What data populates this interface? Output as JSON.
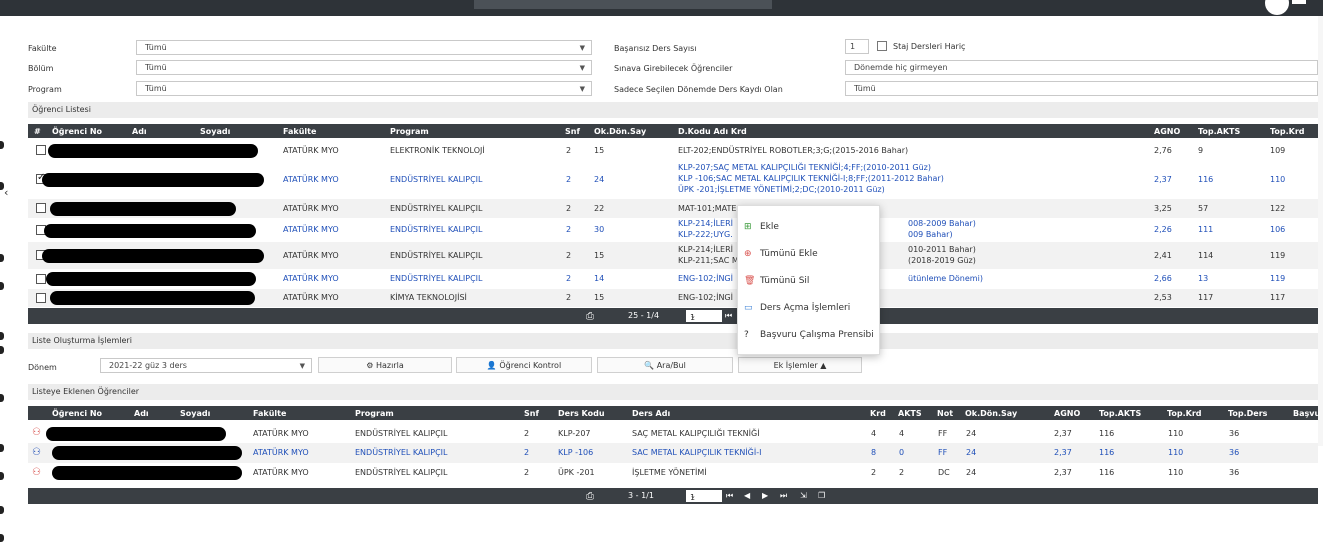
{
  "filters": {
    "fakulte": {
      "label": "Fakülte",
      "value": "Tümü"
    },
    "bolum": {
      "label": "Bölüm",
      "value": "Tümü"
    },
    "program": {
      "label": "Program",
      "value": "Tümü"
    },
    "basarisiz_ders": {
      "label": "Başarısız Ders Sayısı",
      "value": "1"
    },
    "staj_haric": {
      "label": "Staj Dersleri Hariç",
      "checked": false
    },
    "sinava": {
      "label": "Sınava Girebilecek Öğrenciler",
      "value": "Dönemde hiç girmeyen"
    },
    "sadece_secilen": {
      "label": "Sadece Seçilen Dönemde Ders Kaydı Olan",
      "value": "Tümü"
    }
  },
  "ogrenci_listesi": {
    "title": "Öğrenci Listesi",
    "headers": [
      "#",
      "Öğrenci No",
      "Adı",
      "Soyadı",
      "Fakülte",
      "Program",
      "Snf",
      "Ok.Dön.Say",
      "D.Kodu Adı Krd",
      "AGNO",
      "Top.AKTS",
      "Top.Krd"
    ],
    "rows": [
      {
        "fakulte": "ATATÜRK MYO",
        "program": "ELEKTRONİK TEKNOLOJİ",
        "snf": "2",
        "ok": "15",
        "d": [
          "ELT-202;ENDÜSTRİYEL ROBOTLER;3;G;(2015-2016 Bahar)"
        ],
        "agno": "2,76",
        "akts": "9",
        "krd": "109",
        "blue": false,
        "checked": false
      },
      {
        "fakulte": "ATATÜRK MYO",
        "program": "ENDÜSTRİYEL KALIPÇIL",
        "snf": "2",
        "ok": "24",
        "d": [
          "KLP-207;SAÇ METAL KALIPÇILIĞI TEKNİĞİ;4;FF;(2010-2011 Güz)",
          "KLP -106;SAC METAL KALIPÇILIK TEKNİĞİ-I;8;FF;(2011-2012 Bahar)",
          "ÜPK -201;İŞLETME YÖNETİMİ;2;DC;(2010-2011 Güz)"
        ],
        "agno": "2,37",
        "akts": "116",
        "krd": "110",
        "blue": true,
        "checked": true
      },
      {
        "fakulte": "ATATÜRK MYO",
        "program": "ENDÜSTRİYEL KALIPÇIL",
        "snf": "2",
        "ok": "22",
        "d": [
          "MAT-101;MATE"
        ],
        "agno": "3,25",
        "akts": "57",
        "krd": "122",
        "blue": false,
        "checked": false
      },
      {
        "fakulte": "ATATÜRK MYO",
        "program": "ENDÜSTRİYEL KALIPÇIL",
        "snf": "2",
        "ok": "30",
        "d": [
          "KLP-214;İLERİ",
          "KLP-222;UYG."
        ],
        "d2": [
          "008-2009 Bahar)",
          "009 Bahar)"
        ],
        "agno": "2,26",
        "akts": "111",
        "krd": "106",
        "blue": true,
        "checked": false
      },
      {
        "fakulte": "ATATÜRK MYO",
        "program": "ENDÜSTRİYEL KALIPÇIL",
        "snf": "2",
        "ok": "15",
        "d": [
          "KLP-214;İLERİ",
          "KLP-211;SAC M"
        ],
        "d2": [
          "010-2011 Bahar)",
          "(2018-2019 Güz)"
        ],
        "agno": "2,41",
        "akts": "114",
        "krd": "119",
        "blue": false,
        "checked": false
      },
      {
        "fakulte": "ATATÜRK MYO",
        "program": "ENDÜSTRİYEL KALIPÇIL",
        "snf": "2",
        "ok": "14",
        "d": [
          "ENG-102;İNGİ"
        ],
        "d2": [
          "ütünleme Dönemi)"
        ],
        "agno": "2,66",
        "akts": "13",
        "krd": "119",
        "blue": true,
        "checked": false
      },
      {
        "fakulte": "ATATÜRK MYO",
        "program": "KİMYA TEKNOLOJİSİ",
        "snf": "2",
        "ok": "15",
        "d": [
          "ENG-102;İNGİ"
        ],
        "agno": "2,53",
        "akts": "117",
        "krd": "117",
        "blue": false,
        "checked": false
      }
    ],
    "pager": {
      "text": "25 - 1/4",
      "page": "1"
    }
  },
  "context_menu": {
    "items": [
      "Ekle",
      "Tümünü Ekle",
      "Tümünü Sil",
      "Ders Açma İşlemleri",
      "Başvuru Çalışma Prensibi"
    ]
  },
  "liste_olusturma": {
    "title": "Liste Oluşturma İşlemleri",
    "donem_label": "Dönem",
    "donem_value": "2021-22 güz 3 ders",
    "buttons": {
      "hazirla": "Hazırla",
      "ogrenci_kontrol": "Öğrenci Kontrol",
      "ara_bul": "Ara/Bul",
      "ek_islemler": "Ek İşlemler"
    }
  },
  "eklenen": {
    "title": "Listeye Eklenen Öğrenciler",
    "headers": [
      "Öğrenci No",
      "Adı",
      "Soyadı",
      "Fakülte",
      "Program",
      "Snf",
      "Ders Kodu",
      "Ders Adı",
      "Krd",
      "AKTS",
      "Not",
      "Ok.Dön.Say",
      "AGNO",
      "Top.AKTS",
      "Top.Krd",
      "Top.Ders",
      "Başvu"
    ],
    "rows": [
      {
        "fakulte": "ATATÜRK MYO",
        "program": "ENDÜSTRİYEL KALIPÇIL",
        "snf": "2",
        "kod": "KLP-207",
        "ad": "SAÇ METAL KALIPÇILIĞI TEKNİĞİ",
        "krd": "4",
        "akts": "4",
        "not": "FF",
        "ok": "24",
        "agno": "2,37",
        "takts": "116",
        "tkrd": "110",
        "tders": "36",
        "blue": false
      },
      {
        "fakulte": "ATATÜRK MYO",
        "program": "ENDÜSTRİYEL KALIPÇIL",
        "snf": "2",
        "kod": "KLP -106",
        "ad": "SAC METAL KALIPÇILIK TEKNİĞİ-I",
        "krd": "8",
        "akts": "0",
        "not": "FF",
        "ok": "24",
        "agno": "2,37",
        "takts": "116",
        "tkrd": "110",
        "tders": "36",
        "blue": true
      },
      {
        "fakulte": "ATATÜRK MYO",
        "program": "ENDÜSTRİYEL KALIPÇIL",
        "snf": "2",
        "kod": "ÜPK -201",
        "ad": "İŞLETME YÖNETİMİ",
        "krd": "2",
        "akts": "2",
        "not": "DC",
        "ok": "24",
        "agno": "2,37",
        "takts": "116",
        "tkrd": "110",
        "tders": "36",
        "blue": false
      }
    ],
    "pager": {
      "text": "3 - 1/1",
      "page": "1"
    }
  },
  "colors": {
    "header_bg": "#3a3f44",
    "link_blue": "#1f4fb8",
    "danger": "#d9534f"
  }
}
